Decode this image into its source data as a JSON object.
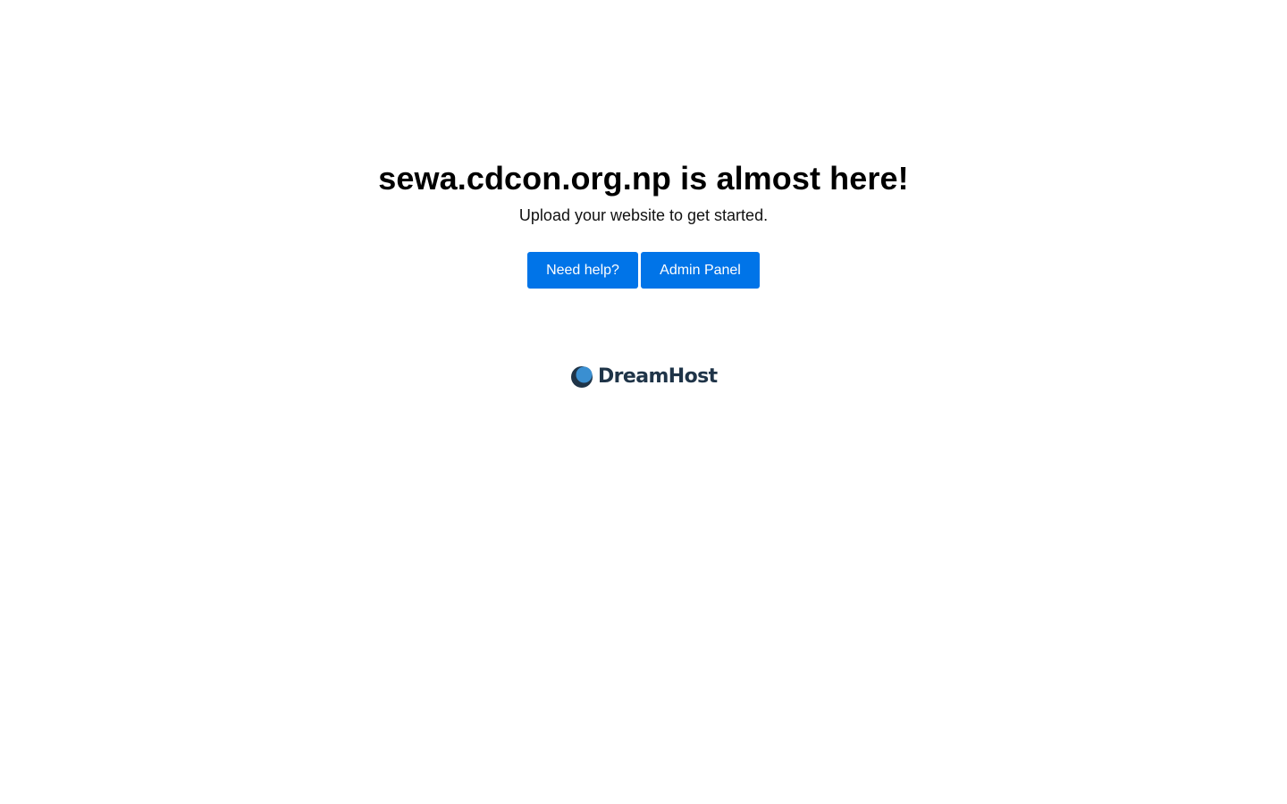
{
  "main": {
    "headline": "sewa.cdcon.org.np is almost here!",
    "subline": "Upload your website to get started.",
    "buttons": {
      "help_label": "Need help?",
      "admin_label": "Admin Panel"
    }
  },
  "footer": {
    "logo_text": "DreamHost",
    "logo_icon": "dreamhost-moon-icon"
  },
  "colors": {
    "button_bg": "#0074e8",
    "button_text": "#ffffff",
    "logo_dark": "#1f3448",
    "logo_accent": "#3a8fd1"
  }
}
